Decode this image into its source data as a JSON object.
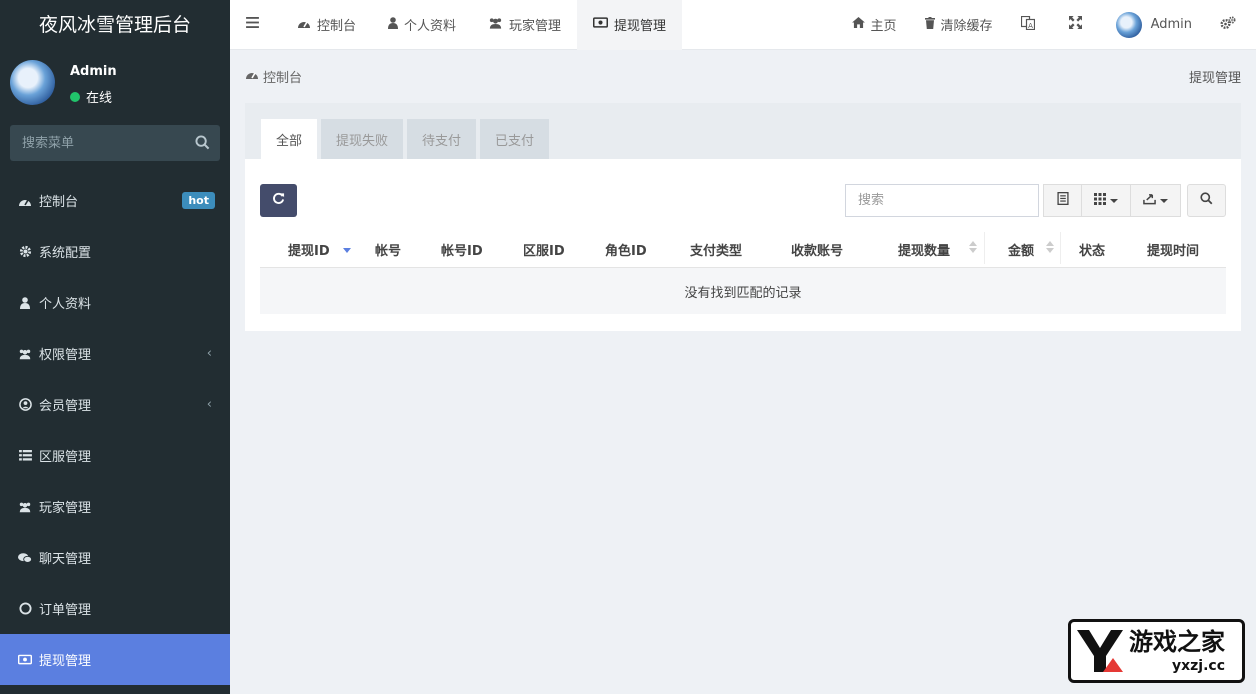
{
  "sidebar": {
    "brand": "夜风冰雪管理后台",
    "user": {
      "name": "Admin",
      "status": "在线"
    },
    "search_placeholder": "搜索菜单",
    "items": [
      {
        "label": "控制台",
        "icon": "dashboard-icon",
        "badge": "hot"
      },
      {
        "label": "系统配置",
        "icon": "gear-icon"
      },
      {
        "label": "个人资料",
        "icon": "user-icon"
      },
      {
        "label": "权限管理",
        "icon": "group-icon",
        "chevron": "‹"
      },
      {
        "label": "会员管理",
        "icon": "user-circle-icon",
        "chevron": "‹"
      },
      {
        "label": "区服管理",
        "icon": "list-icon"
      },
      {
        "label": "玩家管理",
        "icon": "group-icon"
      },
      {
        "label": "聊天管理",
        "icon": "chat-icon"
      },
      {
        "label": "订单管理",
        "icon": "circle-icon"
      },
      {
        "label": "提现管理",
        "icon": "money-icon",
        "active": true
      }
    ]
  },
  "topbar": {
    "tabs": [
      {
        "label": "控制台",
        "icon": "dashboard-icon"
      },
      {
        "label": "个人资料",
        "icon": "user-icon"
      },
      {
        "label": "玩家管理",
        "icon": "group-icon"
      },
      {
        "label": "提现管理",
        "icon": "money-icon",
        "active": true
      }
    ],
    "home": "主页",
    "clear_cache": "清除缓存",
    "user_name": "Admin"
  },
  "breadcrumb": {
    "home": "控制台",
    "current": "提现管理"
  },
  "filter_tabs": [
    "全部",
    "提现失败",
    "待支付",
    "已支付"
  ],
  "toolbar": {
    "search_placeholder": "搜索"
  },
  "table": {
    "columns": [
      "提现ID",
      "帐号",
      "帐号ID",
      "区服ID",
      "角色ID",
      "支付类型",
      "收款账号",
      "提现数量",
      "金额",
      "状态",
      "提现时间"
    ],
    "empty_text": "没有找到匹配的记录"
  },
  "watermark": {
    "name": "游戏之家",
    "url": "yxzj.cc"
  },
  "colors": {
    "sidebar_bg": "#222d32",
    "active": "#5b7fe0",
    "badge": "#3c8dbc",
    "online": "#21c46b",
    "refresh_btn": "#444c6b"
  }
}
